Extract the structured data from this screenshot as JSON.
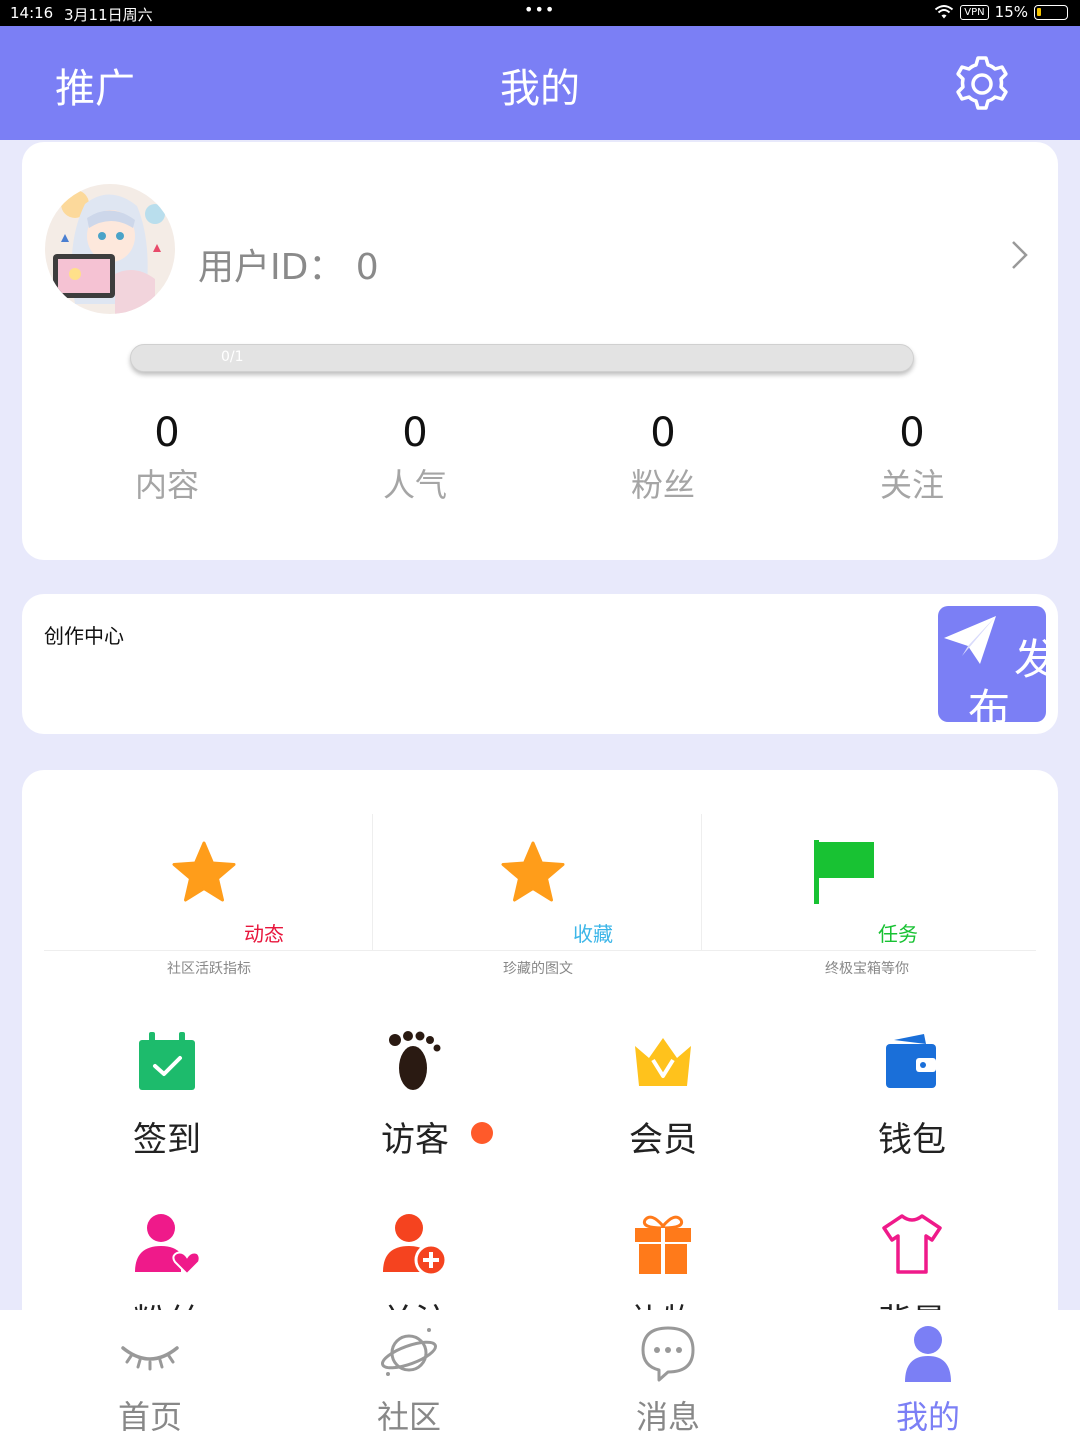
{
  "status_bar": {
    "time": "14:16",
    "date": "3月11日周六",
    "dots": "•••",
    "vpn": "VPN",
    "battery": "15%"
  },
  "header": {
    "left_label": "推广",
    "title": "我的",
    "settings_icon": "gear-icon"
  },
  "profile": {
    "user_id_label": "用户ID：",
    "user_id_value": "0",
    "progress_text": "0/1",
    "progress_fraction": 0,
    "stats": [
      {
        "value": "0",
        "label": "内容"
      },
      {
        "value": "0",
        "label": "人气"
      },
      {
        "value": "0",
        "label": "粉丝"
      },
      {
        "value": "0",
        "label": "关注"
      }
    ]
  },
  "creation": {
    "title": "创作中心",
    "publish_char1": "发",
    "publish_char2": "布"
  },
  "top_features": [
    {
      "label": "动态",
      "sub": "社区活跃指标",
      "color": "#e8163c",
      "icon": "star-icon"
    },
    {
      "label": "收藏",
      "sub": "珍藏的图文",
      "color": "#3cb6e8",
      "icon": "star-icon"
    },
    {
      "label": "任务",
      "sub": "终极宝箱等你",
      "color": "#18c233",
      "icon": "flag-icon"
    }
  ],
  "grid": [
    {
      "label": "签到",
      "icon": "calendar-check-icon"
    },
    {
      "label": "访客",
      "icon": "footprint-icon",
      "badge": true
    },
    {
      "label": "会员",
      "icon": "crown-icon"
    },
    {
      "label": "钱包",
      "icon": "wallet-icon"
    },
    {
      "label": "粉丝",
      "icon": "user-heart-icon"
    },
    {
      "label": "关注",
      "icon": "user-add-icon"
    },
    {
      "label": "礼物",
      "icon": "gift-icon"
    },
    {
      "label": "背景",
      "icon": "shirt-icon"
    }
  ],
  "tabs": [
    {
      "label": "首页",
      "icon": "eye-icon"
    },
    {
      "label": "社区",
      "icon": "planet-icon"
    },
    {
      "label": "消息",
      "icon": "chat-icon"
    },
    {
      "label": "我的",
      "icon": "user-icon",
      "active": true
    }
  ],
  "colors": {
    "accent": "#7b7ff5",
    "background": "#e8e9fb",
    "star": "#ff9d1a",
    "badge": "#ff5a2a"
  }
}
